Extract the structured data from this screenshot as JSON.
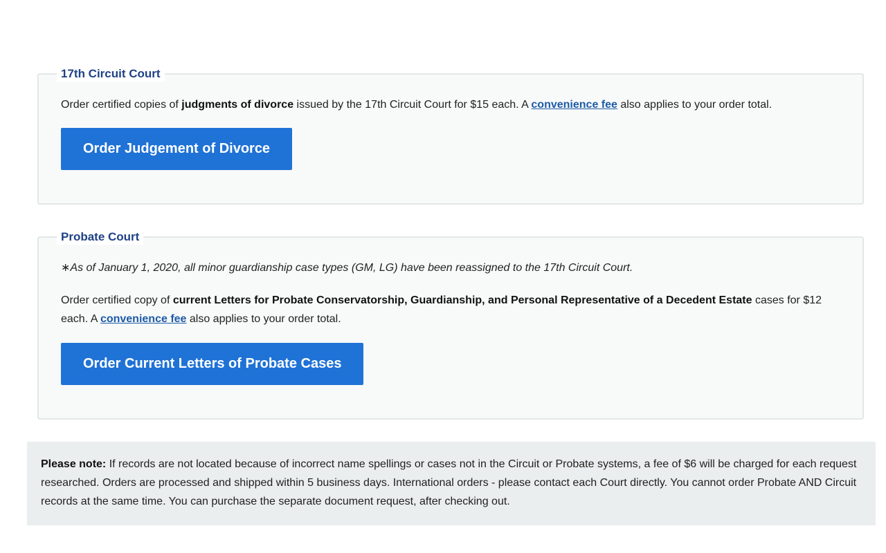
{
  "circuit": {
    "title": "17th Circuit Court",
    "text_before": "Order certified copies of ",
    "text_bold": "judgments of divorce",
    "text_middle": " issued by the 17th Circuit Court for $15 each. A ",
    "link_label": "convenience fee",
    "text_after": " also applies to your order total.",
    "button_label": "Order Judgement of Divorce"
  },
  "probate": {
    "title": "Probate Court",
    "notice": "∗As of January 1, 2020, all minor guardianship case types (GM, LG) have been reassigned to the 17th Circuit Court.",
    "text_before": "Order certified copy of ",
    "text_bold": "current Letters for Probate Conservatorship, Guardianship, and Personal Representative of a Decedent Estate",
    "text_middle": " cases for $12 each. A ",
    "link_label": "convenience fee",
    "text_after": " also applies to your order total.",
    "button_label": "Order Current Letters of Probate Cases"
  },
  "note": {
    "label": "Please note:",
    "text": " If records are not located because of incorrect name spellings or cases not in the Circuit or Probate systems, a fee of $6 will be charged for each request researched. Orders are processed and shipped within 5 business days. International orders - please contact each Court directly. You cannot order Probate AND Circuit records at the same time. You can purchase the separate document request, after checking out."
  },
  "colors": {
    "heading": "#1e4185",
    "button": "#1f72d6",
    "link": "#1d5aa6",
    "note_background": "#ebeeee"
  }
}
